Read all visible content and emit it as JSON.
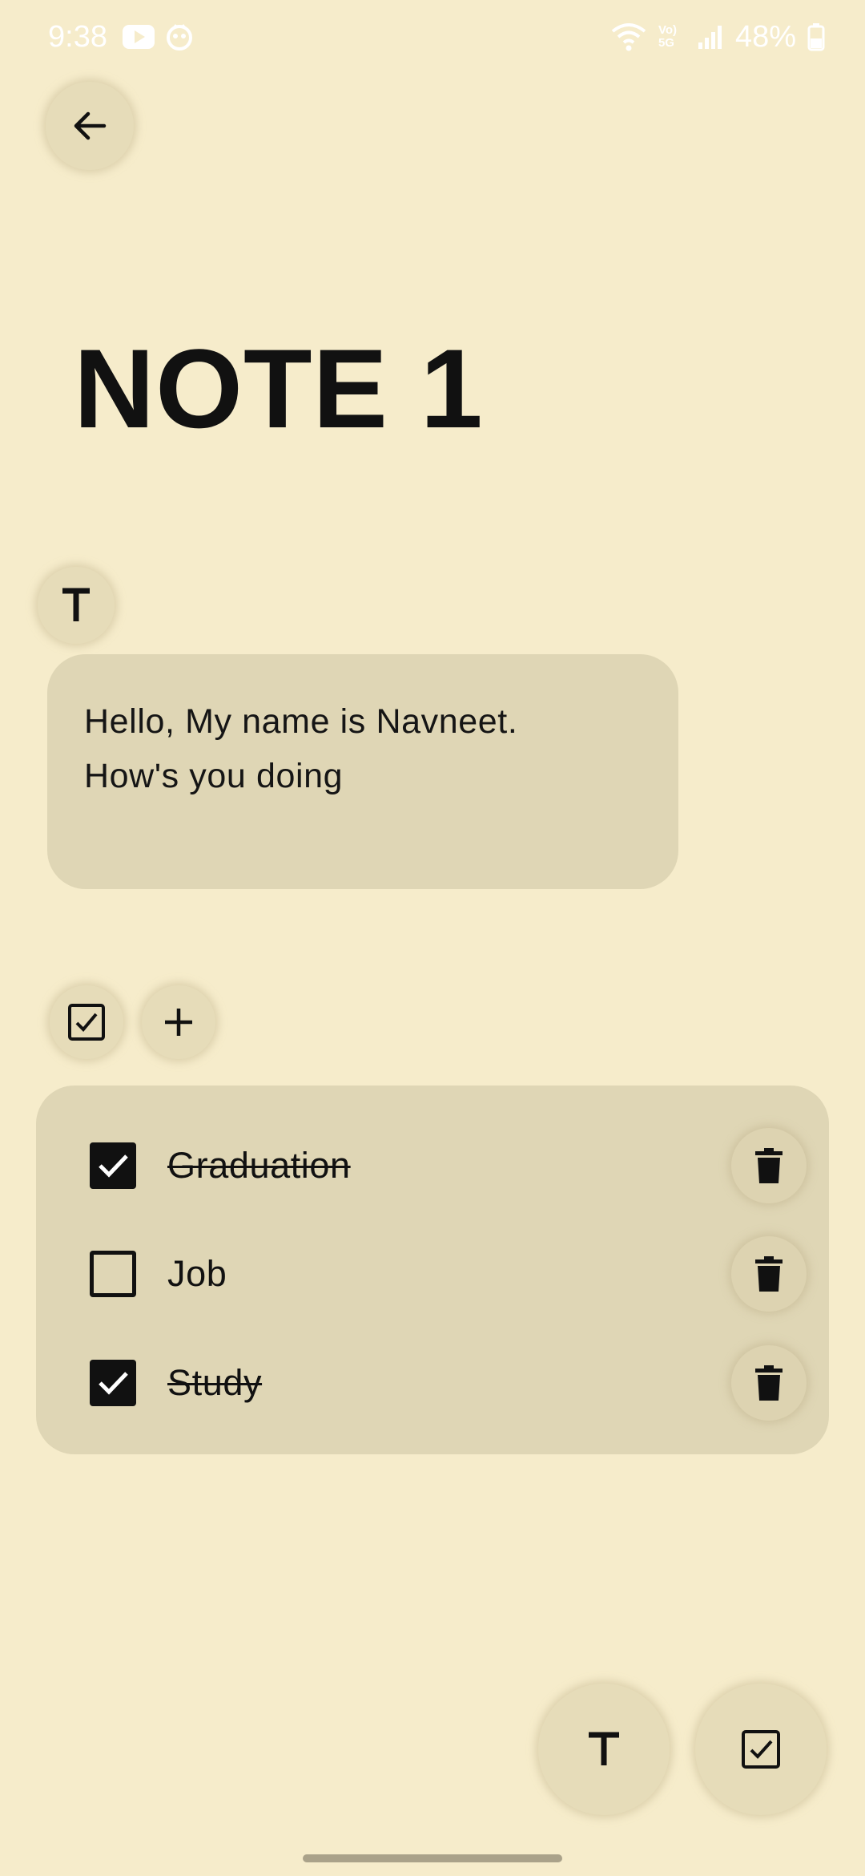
{
  "status_bar": {
    "time": "9:38",
    "network": "Vo) 5G",
    "battery": "48%"
  },
  "title": "NOTE 1",
  "text_block": {
    "lines": [
      "Hello, My name is Navneet.",
      "How's you doing"
    ]
  },
  "checklist": {
    "items": [
      {
        "label": "Graduation",
        "checked": true
      },
      {
        "label": "Job",
        "checked": false
      },
      {
        "label": "Study",
        "checked": true
      }
    ]
  },
  "icons": {
    "back": "arrow-left-icon",
    "text": "text-format-icon",
    "checkbox": "checkbox-icon",
    "add": "plus-icon",
    "delete": "trash-icon"
  },
  "colors": {
    "background": "#F6ECCB",
    "card": "#DFD6B5",
    "button": "#E6DCB9",
    "text": "#111111"
  }
}
